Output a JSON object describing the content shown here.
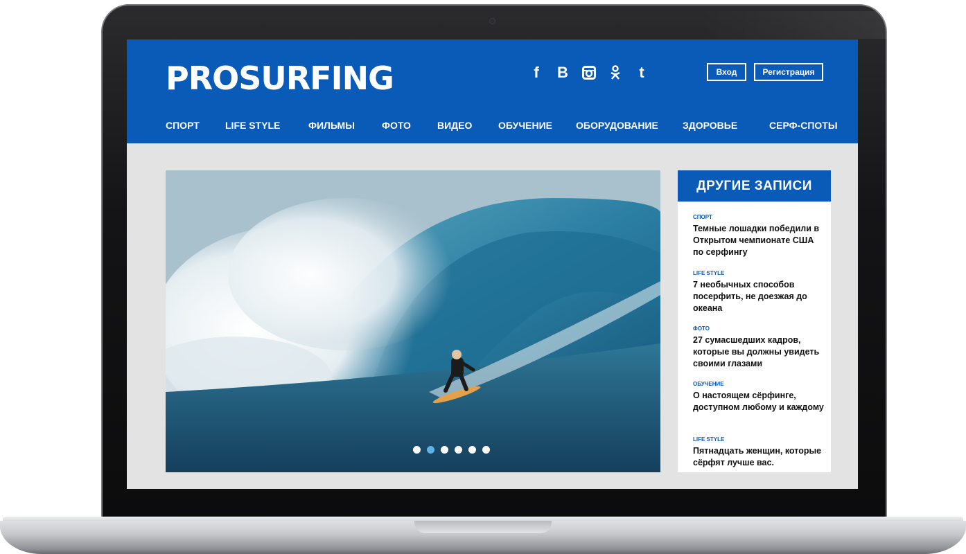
{
  "site": {
    "logo": "PROSURFING",
    "socials": [
      {
        "icon": "facebook-icon",
        "glyph": "f"
      },
      {
        "icon": "vkontakte-icon",
        "glyph": "B"
      },
      {
        "icon": "instagram-icon",
        "glyph": ""
      },
      {
        "icon": "odnoklassniki-icon",
        "glyph": ""
      },
      {
        "icon": "twitter-icon",
        "glyph": "t"
      }
    ],
    "login_label": "Вход",
    "register_label": "Регистрация",
    "nav": [
      "СПОРТ",
      "LIFE STYLE",
      "ФИЛЬМЫ",
      "ФОТО",
      "ВИДЕО",
      "ОБУЧЕНИЕ",
      "ОБОРУДОВАНИЕ",
      "ЗДОРОВЬЕ",
      "СЕРФ-СПОТЫ"
    ]
  },
  "hero": {
    "slide_count": 6,
    "active_slide": 2
  },
  "sidebar": {
    "title": "ДРУГИЕ ЗАПИСИ",
    "posts": [
      {
        "category": "СПОРТ",
        "title": "Темные лошадки победили в Открытом чемпионате США по серфингу"
      },
      {
        "category": "LIFE STYLE",
        "title": "7 необычных способов посерфить, не доезжая до океана"
      },
      {
        "category": "ФОТО",
        "title": "27 сумасшедших кадров, которые вы должны увидеть своими глазами"
      },
      {
        "category": "ОБУЧЕНИЕ",
        "title": "О настоящем сёрфинге, доступном любому и каждому"
      },
      {
        "category": "LIFE STYLE",
        "title": "Пятнадцать женщин, которые сёрфят лучше вас."
      }
    ]
  },
  "colors": {
    "brand_blue": "#0a5ab8",
    "active_dot": "#5fb3e6",
    "page_bg": "#e3e3e3"
  }
}
